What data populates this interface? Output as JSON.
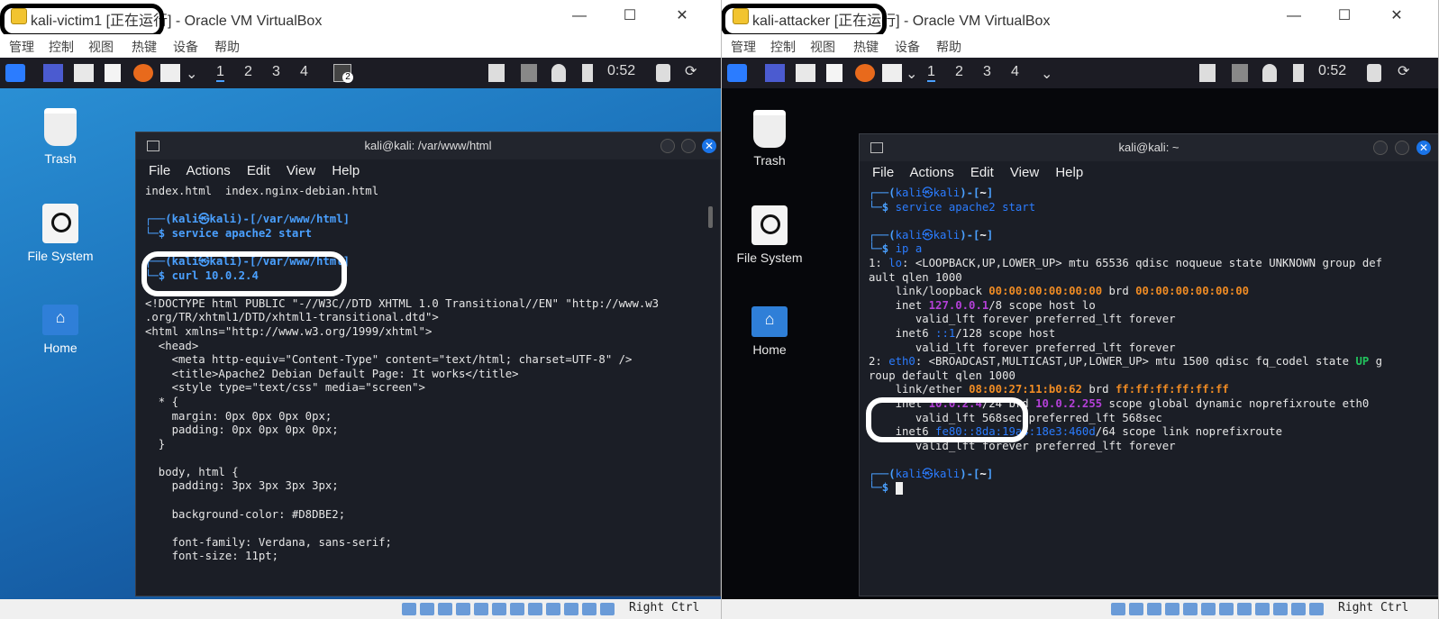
{
  "left_window": {
    "title": "kali-victim1 [正在运行] - Oracle VM VirtualBox",
    "menu": [
      "管理",
      "控制",
      "视图",
      "热键",
      "设备",
      "帮助"
    ],
    "workspaces": [
      "1",
      "2",
      "3",
      "4"
    ],
    "clock": "0:52",
    "terminal_badge": "2",
    "desktop_icons": [
      "Trash",
      "File System",
      "Home"
    ],
    "terminal": {
      "title": "kali@kali: /var/www/html",
      "menu": [
        "File",
        "Actions",
        "Edit",
        "View",
        "Help"
      ],
      "lines": [
        "index.html  index.nginx-debian.html",
        "",
        "┌──(kali㉿kali)-[/var/www/html]",
        "└─$ service apache2 start",
        "",
        "┌──(kali㉿kali)-[/var/www/html]",
        "└─$ curl 10.0.2.4",
        "",
        "<!DOCTYPE html PUBLIC \"-//W3C//DTD XHTML 1.0 Transitional//EN\" \"http://www.w3",
        ".org/TR/xhtml1/DTD/xhtml1-transitional.dtd\">",
        "<html xmlns=\"http://www.w3.org/1999/xhtml\">",
        "  <head>",
        "    <meta http-equiv=\"Content-Type\" content=\"text/html; charset=UTF-8\" />",
        "    <title>Apache2 Debian Default Page: It works</title>",
        "    <style type=\"text/css\" media=\"screen\">",
        "  * {",
        "    margin: 0px 0px 0px 0px;",
        "    padding: 0px 0px 0px 0px;",
        "  }",
        "",
        "  body, html {",
        "    padding: 3px 3px 3px 3px;",
        "",
        "    background-color: #D8DBE2;",
        "",
        "    font-family: Verdana, sans-serif;",
        "    font-size: 11pt;"
      ]
    },
    "status_hotkey": "Right Ctrl"
  },
  "right_window": {
    "title": "kali-attacker [正在运行] - Oracle VM VirtualBox",
    "menu": [
      "管理",
      "控制",
      "视图",
      "热键",
      "设备",
      "帮助"
    ],
    "workspaces": [
      "1",
      "2",
      "3",
      "4"
    ],
    "clock": "0:52",
    "desktop_icons": [
      "Trash",
      "File System",
      "Home"
    ],
    "terminal": {
      "title": "kali@kali: ~",
      "menu": [
        "File",
        "Actions",
        "Edit",
        "View",
        "Help"
      ],
      "prompt_user": "kali",
      "prompt_host": "kali",
      "prompt_dir": "~",
      "cmd1": "service apache2 start",
      "cmd2": "ip a",
      "lo_line1": ": <LOOPBACK,UP,LOWER_UP> mtu 65536 qdisc noqueue state UNKNOWN group def",
      "lo_line2": "ault qlen 1000",
      "lo_link": "00:00:00:00:00:00",
      "lo_brd": "00:00:00:00:00:00",
      "lo_inet": "127.0.0.1",
      "lo_inet6": "::1",
      "eth0_line1a": ": <BROADCAST,MULTICAST,UP,LOWER_UP> mtu 1500 qdisc fq_codel state ",
      "eth0_state": "UP",
      "eth0_line1b": " g",
      "eth0_line2": "roup default qlen 1000",
      "eth0_link": "08:00:27:11:b0:62",
      "eth0_brd": "ff:ff:ff:ff:ff:ff",
      "eth0_inet": "10.0.2.4",
      "eth0_inet_brd": "10.0.2.255",
      "eth0_inet_rest": " scope global dynamic noprefixroute eth0",
      "eth0_valid": "valid_lft 568sec preferred_lft 568sec",
      "eth0_inet6": "fe80::8da:19a4:18e3:460d",
      "eth0_inet6_rest": "/64 scope link noprefixroute",
      "forever": "valid_lft forever preferred_lft forever"
    },
    "status_hotkey": "Right Ctrl"
  }
}
